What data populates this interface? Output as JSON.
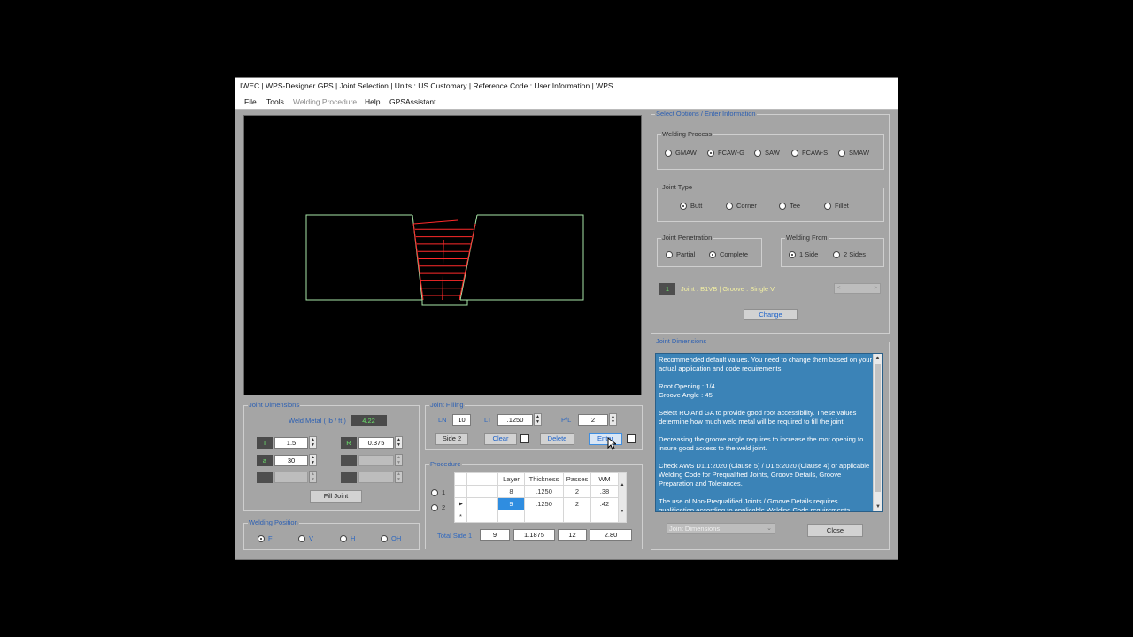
{
  "window": {
    "title": "IWEC | WPS-Designer GPS | Joint Selection | Units : US Customary | Reference Code : User Information | WPS"
  },
  "menu": [
    "File",
    "Tools",
    "Welding Procedure",
    "Help",
    "GPSAssistant"
  ],
  "joint_dimensions": {
    "title": "Joint Dimensions",
    "weld_metal_label": "Weld Metal ( lb / ft )",
    "weld_metal_value": "4.22",
    "T_label": "T",
    "T_value": "1.5",
    "R_label": "R",
    "R_value": "0.375",
    "a_label": "a",
    "a_value": "30",
    "fill_joint_button": "Fill Joint"
  },
  "welding_position": {
    "title": "Welding Position",
    "options": [
      "F",
      "V",
      "H",
      "OH"
    ],
    "selected": "F"
  },
  "joint_filling": {
    "title": "Joint Filling",
    "ln_label": "LN",
    "ln_value": "10",
    "lt_label": "LT",
    "lt_value": ".1250",
    "pl_label": "P/L",
    "pl_value": "2",
    "side2_button": "Side 2",
    "clear_button": "Clear",
    "delete_button": "Delete",
    "enter_button": "Enter"
  },
  "procedure": {
    "title": "Procedure",
    "row_radio_labels": [
      "1",
      "2"
    ],
    "columns": [
      "Layer",
      "Thickness",
      "Passes",
      "WM"
    ],
    "rows": [
      {
        "layer": "8",
        "thickness": ".1250",
        "passes": "2",
        "wm": ".38"
      },
      {
        "layer": "9",
        "thickness": ".1250",
        "passes": "2",
        "wm": ".42"
      }
    ],
    "new_row_marker": "*",
    "current_row_marker": "▶",
    "total_label": "Total Side 1",
    "total_layer": "9",
    "total_thickness": "1.1875",
    "total_passes": "12",
    "total_wm": "2.80"
  },
  "select_options": {
    "title": "Select Options / Enter Information",
    "welding_process": {
      "title": "Welding Process",
      "options": [
        "GMAW",
        "FCAW-G",
        "SAW",
        "FCAW-S",
        "SMAW"
      ],
      "selected": "FCAW-G"
    },
    "joint_type": {
      "title": "Joint Type",
      "options": [
        "Butt",
        "Corner",
        "Tee",
        "Fillet"
      ],
      "selected": "Butt"
    },
    "joint_penetration": {
      "title": "Joint Penetration",
      "options": [
        "Partial",
        "Complete"
      ],
      "selected": "Complete"
    },
    "welding_from": {
      "title": "Welding From",
      "options": [
        "1 Side",
        "2 Sides"
      ],
      "selected": "1 Side"
    },
    "joint_number": "1",
    "joint_info": "Joint : B1VB | Groove : Single V",
    "change_button": "Change"
  },
  "info_panel": {
    "title": "Joint Dimensions",
    "paragraphs": [
      "Recommended default values. You need to change them based on your actual application and code requirements.",
      "Root Opening : 1/4\nGroove Angle : 45",
      "Select RO And GA to provide good root accessibility. These values determine how much weld metal will be required to fill the joint.",
      "Decreasing the groove angle requires to increase the root opening to insure good access to the weld joint.",
      "Check AWS D1.1:2020 (Clause 5) / D1.5:2020 (Clause 4) or applicable Welding Code for Prequalified Joints, Groove Details, Groove Preparation and Tolerances.",
      "The use of Non-Prequalified Joints / Groove Details requires qualification according to applicable Welding Code requirements."
    ],
    "dropdown_value": "Joint Dimensions",
    "close_button": "Close"
  },
  "colors": {
    "window_bg": "#a5a5a5",
    "group_title": "#2b5fb3",
    "plate_outline": "#a8e6a8",
    "weld_layers": "#ff2a2a",
    "info_bg": "#3b83b7"
  }
}
